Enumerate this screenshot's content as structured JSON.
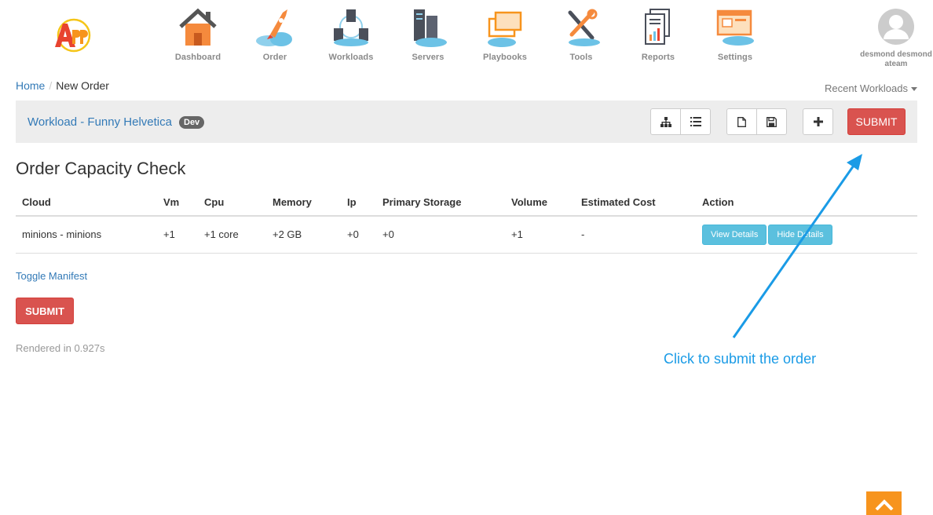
{
  "nav": {
    "items": [
      {
        "label": "Dashboard",
        "icon": "house-icon"
      },
      {
        "label": "Order",
        "icon": "rocket-icon"
      },
      {
        "label": "Workloads",
        "icon": "workloads-icon"
      },
      {
        "label": "Servers",
        "icon": "servers-icon"
      },
      {
        "label": "Playbooks",
        "icon": "playbooks-icon"
      },
      {
        "label": "Tools",
        "icon": "tools-icon"
      },
      {
        "label": "Reports",
        "icon": "reports-icon"
      },
      {
        "label": "Settings",
        "icon": "settings-icon"
      }
    ],
    "user": {
      "name": "desmond desmond",
      "team": "ateam"
    }
  },
  "breadcrumb": {
    "home": "Home",
    "current": "New Order"
  },
  "recent_label": "Recent Workloads",
  "workload": {
    "title": "Workload - Funny Helvetica",
    "badge": "Dev",
    "submit_label": "SUBMIT"
  },
  "heading": "Order Capacity Check",
  "table": {
    "headers": [
      "Cloud",
      "Vm",
      "Cpu",
      "Memory",
      "Ip",
      "Primary Storage",
      "Volume",
      "Estimated Cost",
      "Action"
    ],
    "rows": [
      {
        "cloud": "minions - minions",
        "vm": "+1",
        "cpu": "+1 core",
        "memory": "+2 GB",
        "ip": "+0",
        "primary_storage": "+0",
        "volume": "+1",
        "cost": "-",
        "view_label": "View Details",
        "hide_label": "Hide Details"
      }
    ]
  },
  "toggle_label": "Toggle Manifest",
  "submit_label": "SUBMIT",
  "rendered": "Rendered in 0.927s",
  "annotation": "Click to submit the order",
  "colors": {
    "primary": "#337ab7",
    "danger": "#d9534f",
    "info": "#5bc0de",
    "accent": "#f7941d",
    "annotation": "#1a9be6"
  }
}
